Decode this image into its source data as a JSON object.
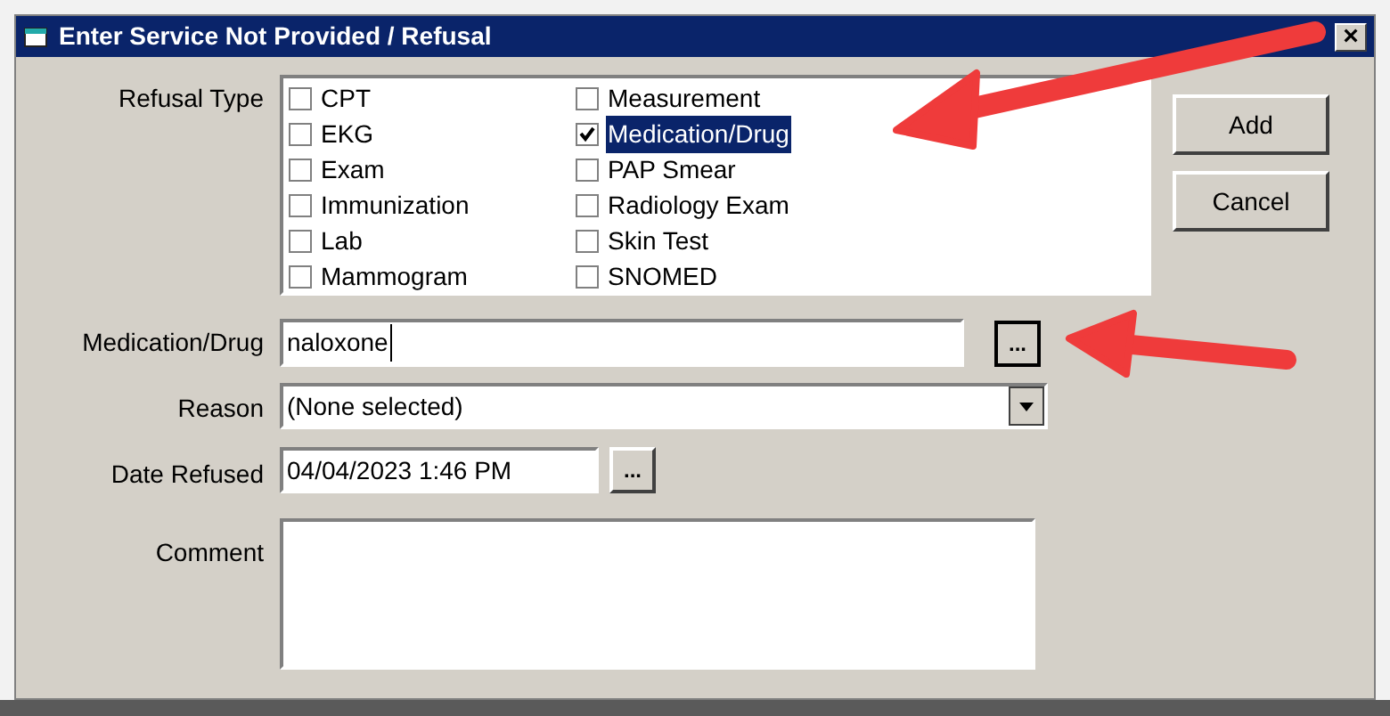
{
  "window": {
    "title": "Enter Service Not Provided / Refusal",
    "close": "×"
  },
  "refusal_type": {
    "label": "Refusal Type",
    "columns": [
      [
        {
          "label": "CPT",
          "checked": false,
          "selected": false
        },
        {
          "label": "EKG",
          "checked": false,
          "selected": false
        },
        {
          "label": "Exam",
          "checked": false,
          "selected": false
        },
        {
          "label": "Immunization",
          "checked": false,
          "selected": false
        },
        {
          "label": "Lab",
          "checked": false,
          "selected": false
        },
        {
          "label": "Mammogram",
          "checked": false,
          "selected": false
        }
      ],
      [
        {
          "label": "Measurement",
          "checked": false,
          "selected": false
        },
        {
          "label": "Medication/Drug",
          "checked": true,
          "selected": true
        },
        {
          "label": "PAP Smear",
          "checked": false,
          "selected": false
        },
        {
          "label": "Radiology Exam",
          "checked": false,
          "selected": false
        },
        {
          "label": "Skin Test",
          "checked": false,
          "selected": false
        },
        {
          "label": "SNOMED",
          "checked": false,
          "selected": false
        }
      ]
    ]
  },
  "buttons": [
    "Add",
    "Cancel"
  ],
  "medication": {
    "label": "Medication/Drug",
    "value": "naloxone",
    "browse": "..."
  },
  "reason": {
    "label": "Reason",
    "value": "(None selected)"
  },
  "date_refused": {
    "label": "Date Refused",
    "value": "04/04/2023 1:46 PM",
    "browse": "..."
  },
  "comment": {
    "label": "Comment"
  }
}
